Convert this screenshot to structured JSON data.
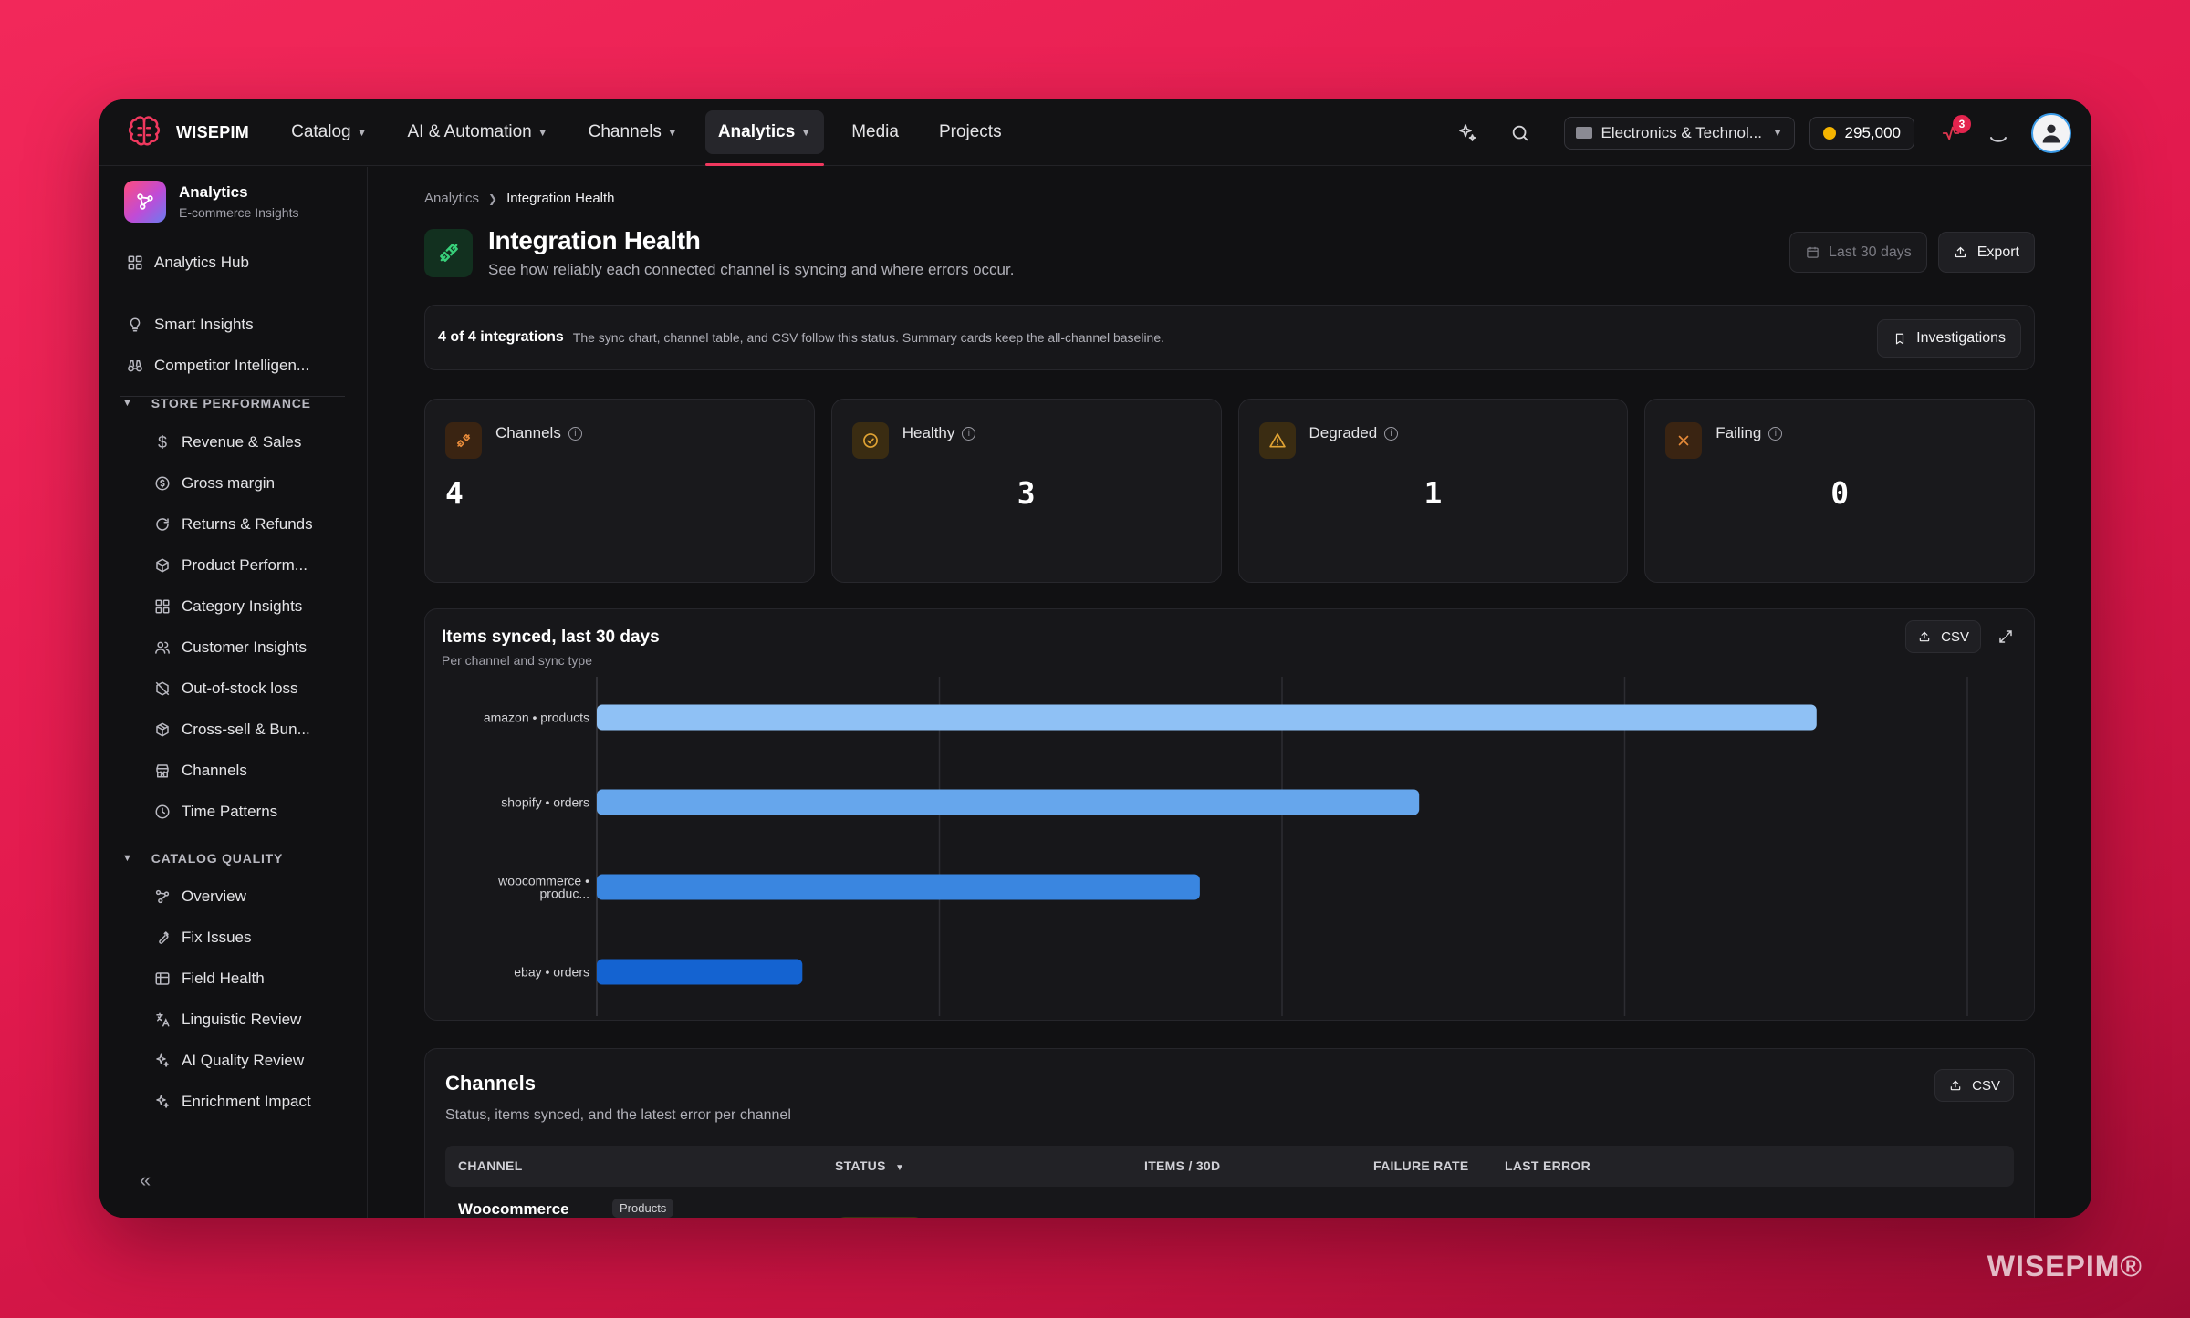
{
  "brand": {
    "name": "WISEPIM",
    "watermark": "WISEPIM®"
  },
  "nav": {
    "items": [
      {
        "label": "Catalog",
        "dropdown": true
      },
      {
        "label": "AI & Automation",
        "dropdown": true
      },
      {
        "label": "Channels",
        "dropdown": true
      },
      {
        "label": "Analytics",
        "dropdown": true,
        "active": true
      },
      {
        "label": "Media",
        "dropdown": false
      },
      {
        "label": "Projects",
        "dropdown": false
      }
    ]
  },
  "topbar": {
    "store": "Electronics & Technol...",
    "credits": "295,000",
    "notifications": "3"
  },
  "sidebar": {
    "title": "Analytics",
    "subtitle": "E-commerce Insights",
    "hub": "Analytics Hub",
    "top_items": [
      "Smart Insights",
      "Competitor Intelligen..."
    ],
    "store_section": "STORE PERFORMANCE",
    "store_items": [
      "Revenue & Sales",
      "Gross margin",
      "Returns & Refunds",
      "Product Perform...",
      "Category Insights",
      "Customer Insights",
      "Out-of-stock loss",
      "Cross-sell & Bun...",
      "Channels",
      "Time Patterns"
    ],
    "catalog_section": "CATALOG QUALITY",
    "catalog_items": [
      "Overview",
      "Fix Issues",
      "Field Health",
      "Linguistic Review",
      "AI Quality Review",
      "Enrichment Impact"
    ]
  },
  "breadcrumb": {
    "parent": "Analytics",
    "current": "Integration Health"
  },
  "page": {
    "title": "Integration Health",
    "subtitle": "See how reliably each connected channel is syncing and where errors occur.",
    "date_range": "Last 30 days",
    "export": "Export"
  },
  "status_bar": {
    "count": "4 of 4 integrations",
    "note": "The sync chart, channel table, and CSV follow this status. Summary cards keep the all-channel baseline.",
    "investigations": "Investigations"
  },
  "kpis": [
    {
      "label": "Channels",
      "value": "4",
      "color": "#e58a3a",
      "bg": "#3a2412",
      "align": "left"
    },
    {
      "label": "Healthy",
      "value": "3",
      "color": "#e0a334",
      "bg": "#3a2c12",
      "align": "center"
    },
    {
      "label": "Degraded",
      "value": "1",
      "color": "#e0a334",
      "bg": "#3a2c12",
      "align": "center"
    },
    {
      "label": "Failing",
      "value": "0",
      "color": "#e58a3a",
      "bg": "#3a2412",
      "align": "center"
    }
  ],
  "chart": {
    "title": "Items synced, last 30 days",
    "subtitle": "Per channel and sync type",
    "csv": "CSV"
  },
  "chart_data": {
    "type": "bar",
    "orientation": "horizontal",
    "categories": [
      "amazon • products",
      "shopify • orders",
      "woocommerce • produc...",
      "ebay • orders"
    ],
    "values": [
      89,
      60,
      44,
      15
    ],
    "xlim": [
      0,
      100
    ],
    "grid": true,
    "colors": [
      "#8fc1f5",
      "#66a6ec",
      "#3a86e0",
      "#1463d1"
    ]
  },
  "table": {
    "title": "Channels",
    "subtitle": "Status, items synced, and the latest error per channel",
    "csv": "CSV",
    "columns": [
      "CHANNEL",
      "STATUS",
      "ITEMS / 30D",
      "FAILURE RATE",
      "LAST ERROR"
    ],
    "rows": [
      {
        "channel": "Woocommerce",
        "tag": "Products"
      }
    ]
  }
}
